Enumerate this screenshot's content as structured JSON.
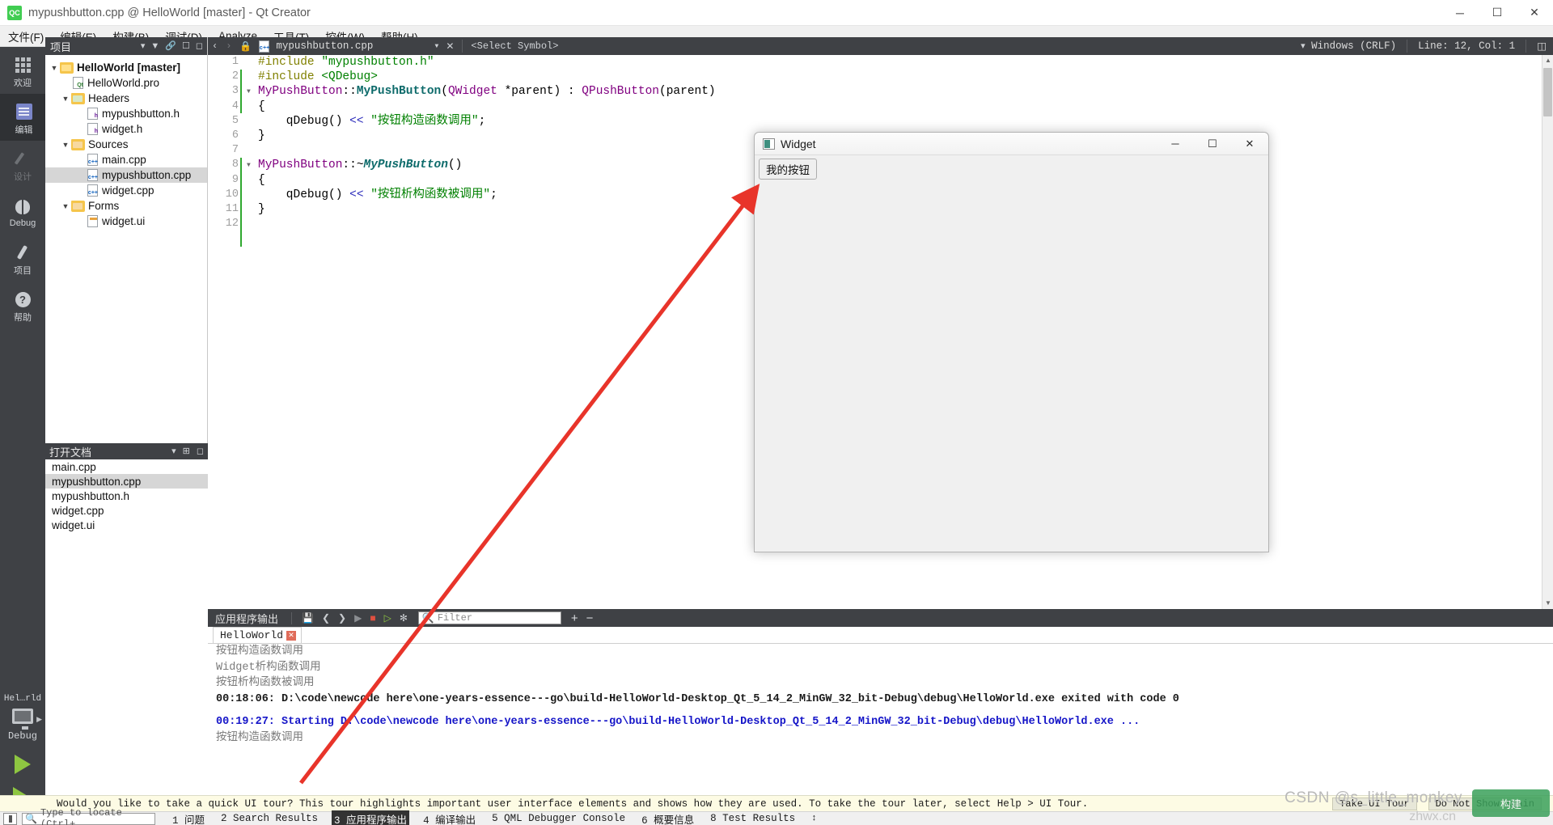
{
  "titlebar": {
    "icon": "qt-creator-icon",
    "title": "mypushbutton.cpp @ HelloWorld [master] - Qt Creator",
    "minimize": "─",
    "maximize": "☐",
    "close": "✕"
  },
  "menubar": {
    "items": [
      {
        "label": "文件(F)"
      },
      {
        "label": "编辑(E)"
      },
      {
        "label": "构建(B)"
      },
      {
        "label": "调试(D)"
      },
      {
        "label": "Analyze"
      },
      {
        "label": "工具(T)"
      },
      {
        "label": "控件(W)"
      },
      {
        "label": "帮助(H)"
      }
    ]
  },
  "modebar": {
    "modes": [
      {
        "label": "欢迎",
        "icon": "grid-icon",
        "active": false
      },
      {
        "label": "编辑",
        "icon": "edit-icon",
        "active": true
      },
      {
        "label": "设计",
        "icon": "pencil-icon",
        "active": false
      },
      {
        "label": "Debug",
        "icon": "bug-icon",
        "active": false
      },
      {
        "label": "项目",
        "icon": "wrench-icon",
        "active": false
      },
      {
        "label": "帮助",
        "icon": "help-icon",
        "active": false
      }
    ],
    "kit": {
      "project": "Hel…rld",
      "build_config": "Debug",
      "run_label": "run-button",
      "debug_label": "debug-button"
    }
  },
  "sidepanel": {
    "header": "项目",
    "tools": [
      "filter-icon",
      "link-icon",
      "split-icon",
      "close-icon"
    ],
    "tree": [
      {
        "label": "HelloWorld [master]",
        "indent": 0,
        "icon": "folder-qt",
        "chevron": "v",
        "bold": true,
        "selected": false
      },
      {
        "label": "HelloWorld.pro",
        "indent": 1,
        "icon": "file-pro",
        "chevron": "",
        "bold": false,
        "selected": false
      },
      {
        "label": "Headers",
        "indent": 1,
        "icon": "folder-h",
        "chevron": "v",
        "bold": false,
        "selected": false
      },
      {
        "label": "mypushbutton.h",
        "indent": 2,
        "icon": "file-h",
        "chevron": "",
        "bold": false,
        "selected": false
      },
      {
        "label": "widget.h",
        "indent": 2,
        "icon": "file-h",
        "chevron": "",
        "bold": false,
        "selected": false
      },
      {
        "label": "Sources",
        "indent": 1,
        "icon": "folder-cpp",
        "chevron": "v",
        "bold": false,
        "selected": false
      },
      {
        "label": "main.cpp",
        "indent": 2,
        "icon": "file-cpp",
        "chevron": "",
        "bold": false,
        "selected": false
      },
      {
        "label": "mypushbutton.cpp",
        "indent": 2,
        "icon": "file-cpp",
        "chevron": "",
        "bold": false,
        "selected": true
      },
      {
        "label": "widget.cpp",
        "indent": 2,
        "icon": "file-cpp",
        "chevron": "",
        "bold": false,
        "selected": false
      },
      {
        "label": "Forms",
        "indent": 1,
        "icon": "folder-ui",
        "chevron": "v",
        "bold": false,
        "selected": false
      },
      {
        "label": "widget.ui",
        "indent": 2,
        "icon": "file-ui",
        "chevron": "",
        "bold": false,
        "selected": false
      }
    ]
  },
  "opendocs": {
    "header": "打开文档",
    "items": [
      {
        "label": "main.cpp",
        "selected": false
      },
      {
        "label": "mypushbutton.cpp",
        "selected": true
      },
      {
        "label": "mypushbutton.h",
        "selected": false
      },
      {
        "label": "widget.cpp",
        "selected": false
      },
      {
        "label": "widget.ui",
        "selected": false
      }
    ]
  },
  "editor_toolbar": {
    "back": "‹",
    "forward": "›",
    "lock": "lock-icon",
    "document": "mypushbutton.cpp",
    "close": "✕",
    "symbol": "<Select Symbol>",
    "line_ending": "Windows (CRLF)",
    "position": "Line: 12, Col: 1",
    "split": "split-icon"
  },
  "code": {
    "lines": [
      {
        "num": "1",
        "fold": "",
        "segments": [
          {
            "t": "#include ",
            "c": "k-pre"
          },
          {
            "t": "\"mypushbutton.h\"",
            "c": "k-str"
          }
        ]
      },
      {
        "num": "2",
        "fold": "",
        "segments": [
          {
            "t": "#include ",
            "c": "k-pre"
          },
          {
            "t": "<QDebug>",
            "c": "k-str"
          }
        ]
      },
      {
        "num": "3",
        "fold": "v",
        "segments": [
          {
            "t": "MyPushButton",
            "c": "k-cls"
          },
          {
            "t": "::",
            "c": "k-plain"
          },
          {
            "t": "MyPushButton",
            "c": "k-fnb"
          },
          {
            "t": "(",
            "c": "k-plain"
          },
          {
            "t": "QWidget",
            "c": "k-cls"
          },
          {
            "t": " *parent) : ",
            "c": "k-plain"
          },
          {
            "t": "QPushButton",
            "c": "k-cls"
          },
          {
            "t": "(parent)",
            "c": "k-plain"
          }
        ]
      },
      {
        "num": "4",
        "fold": "",
        "segments": [
          {
            "t": "{",
            "c": "k-plain"
          }
        ]
      },
      {
        "num": "5",
        "fold": "",
        "segments": [
          {
            "t": "    qDebug() ",
            "c": "k-plain"
          },
          {
            "t": "<< ",
            "c": "k-op"
          },
          {
            "t": "\"按钮构造函数调用\"",
            "c": "k-str"
          },
          {
            "t": ";",
            "c": "k-plain"
          }
        ]
      },
      {
        "num": "6",
        "fold": "",
        "segments": [
          {
            "t": "}",
            "c": "k-plain"
          }
        ]
      },
      {
        "num": "7",
        "fold": "",
        "segments": [
          {
            "t": "",
            "c": "k-plain"
          }
        ]
      },
      {
        "num": "8",
        "fold": "v",
        "segments": [
          {
            "t": "MyPushButton",
            "c": "k-cls"
          },
          {
            "t": "::~",
            "c": "k-plain"
          },
          {
            "t": "MyPushButton",
            "c": "k-fn"
          },
          {
            "t": "()",
            "c": "k-plain"
          }
        ]
      },
      {
        "num": "9",
        "fold": "",
        "segments": [
          {
            "t": "{",
            "c": "k-plain"
          }
        ]
      },
      {
        "num": "10",
        "fold": "",
        "segments": [
          {
            "t": "    qDebug() ",
            "c": "k-plain"
          },
          {
            "t": "<< ",
            "c": "k-op"
          },
          {
            "t": "\"按钮析构函数被调用\"",
            "c": "k-str"
          },
          {
            "t": ";",
            "c": "k-plain"
          }
        ]
      },
      {
        "num": "11",
        "fold": "",
        "segments": [
          {
            "t": "}",
            "c": "k-plain"
          }
        ]
      },
      {
        "num": "12",
        "fold": "",
        "segments": [
          {
            "t": "",
            "c": "k-plain"
          }
        ]
      }
    ]
  },
  "output": {
    "title": "应用程序输出",
    "toolbar_icons": [
      "save-output-icon",
      "prev-icon",
      "next-icon",
      "run-icon",
      "stop-icon",
      "rerun-icon",
      "attach-icon"
    ],
    "filter_placeholder": "Filter",
    "add": "+",
    "remove": "−",
    "tab": {
      "label": "HelloWorld",
      "close": "✕"
    },
    "lines": [
      {
        "text": "按钮构造函数调用",
        "style": "gray"
      },
      {
        "text": "Widget析构函数调用",
        "style": "gray"
      },
      {
        "text": "按钮析构函数被调用",
        "style": "gray"
      },
      {
        "text": "00:18:06: D:\\code\\newcode here\\one-years-essence---go\\build-HelloWorld-Desktop_Qt_5_14_2_MinGW_32_bit-Debug\\debug\\HelloWorld.exe exited with code 0",
        "style": "dark"
      },
      {
        "text": "",
        "style": "spacer"
      },
      {
        "text": "00:19:27: Starting D:\\code\\newcode here\\one-years-essence---go\\build-HelloWorld-Desktop_Qt_5_14_2_MinGW_32_bit-Debug\\debug\\HelloWorld.exe ...",
        "style": "blue"
      },
      {
        "text": "按钮构造函数调用",
        "style": "gray"
      }
    ]
  },
  "tourbar": {
    "text": "Would you like to take a quick UI tour? This tour highlights important user interface elements and shows how they are used. To take the tour later, select Help > UI Tour.",
    "take_tour": "Take UI Tour",
    "do_not": "Do Not Show Again"
  },
  "statusbar": {
    "locate_placeholder": "Type to locate (Ctrl+...",
    "items": [
      {
        "label": "1 问题",
        "selected": false
      },
      {
        "label": "2 Search Results",
        "selected": false
      },
      {
        "label": "3 应用程序输出",
        "selected": true
      },
      {
        "label": "4 编译输出",
        "selected": false
      },
      {
        "label": "5 QML Debugger Console",
        "selected": false
      },
      {
        "label": "6 概要信息",
        "selected": false
      },
      {
        "label": "8 Test Results",
        "selected": false
      }
    ],
    "updown": "↕"
  },
  "widget_window": {
    "title": "Widget",
    "minimize": "─",
    "maximize": "☐",
    "close": "✕",
    "button_label": "我的按钮"
  },
  "watermark": {
    "text": "CSDN @s_little_monkey",
    "text2": "zhwx.cn",
    "badge": "构建"
  },
  "colors": {
    "accent": "#41cd52",
    "panel_dark": "#3f4145",
    "selection": "#d6d6d6",
    "arrow": "#e8342a"
  }
}
